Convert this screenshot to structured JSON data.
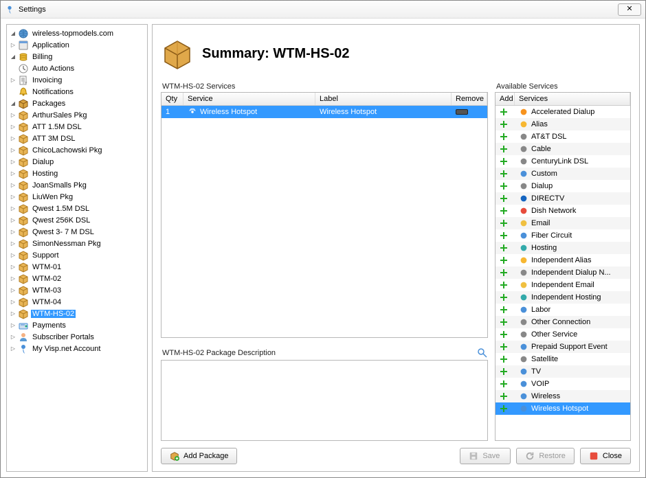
{
  "window": {
    "title": "Settings",
    "close_label": "✕"
  },
  "tree": {
    "root": "wireless-topmodels.com",
    "application": "Application",
    "billing": "Billing",
    "auto_actions": "Auto Actions",
    "invoicing": "Invoicing",
    "notifications": "Notifications",
    "packages": "Packages",
    "package_items": [
      "ArthurSales Pkg",
      "ATT 1.5M DSL",
      "ATT 3M DSL",
      "ChicoLachowski Pkg",
      "Dialup",
      "Hosting",
      "JoanSmalls Pkg",
      "LiuWen Pkg",
      "Qwest 1.5M DSL",
      "Qwest 256K DSL",
      "Qwest 3- 7 M DSL",
      "SimonNessman Pkg",
      "Support",
      "WTM-01",
      "WTM-02",
      "WTM-03",
      "WTM-04",
      "WTM-HS-02"
    ],
    "payments": "Payments",
    "subscriber_portals": "Subscriber Portals",
    "my_account": "My Visp.net Account"
  },
  "selected_package": "WTM-HS-02",
  "header": {
    "prefix": "Summary: ",
    "name": "WTM-HS-02"
  },
  "services_table": {
    "title": "WTM-HS-02 Services",
    "cols": {
      "qty": "Qty",
      "service": "Service",
      "label": "Label",
      "remove": "Remove"
    },
    "rows": [
      {
        "qty": "1",
        "service": "Wireless Hotspot",
        "label": "Wireless Hotspot"
      }
    ]
  },
  "desc": {
    "title": "WTM-HS-02 Package Description"
  },
  "available": {
    "title": "Available Services",
    "cols": {
      "add": "Add",
      "services": "Services"
    },
    "items": [
      "Accelerated Dialup",
      "Alias",
      "AT&T DSL",
      "Cable",
      "CenturyLink DSL",
      "Custom",
      "Dialup",
      "DIRECTV",
      "Dish Network",
      "Email",
      "Fiber Circuit",
      "Hosting",
      "Independent Alias",
      "Independent Dialup N...",
      "Independent Email",
      "Independent Hosting",
      "Labor",
      "Other Connection",
      "Other Service",
      "Prepaid Support Event",
      "Satellite",
      "TV",
      "VOIP",
      "Wireless",
      "Wireless Hotspot"
    ],
    "selected": "Wireless Hotspot"
  },
  "buttons": {
    "add_package": "Add Package",
    "save": "Save",
    "restore": "Restore",
    "close": "Close"
  }
}
